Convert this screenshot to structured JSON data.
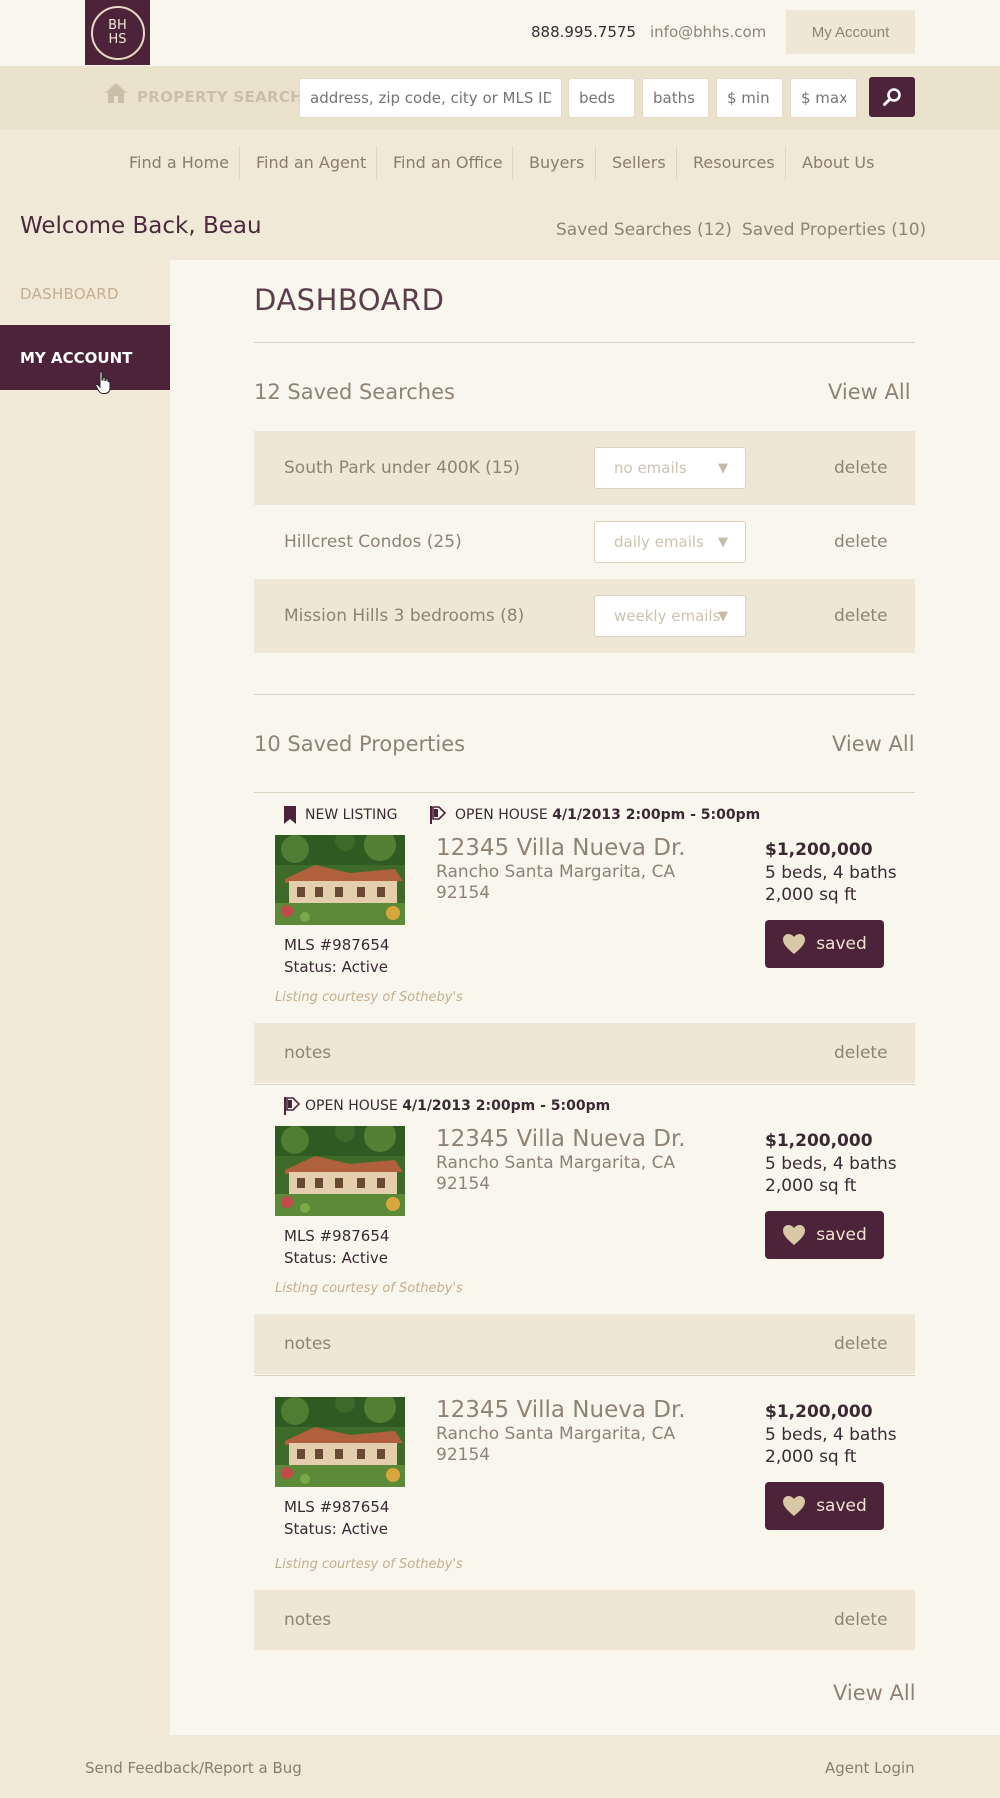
{
  "header": {
    "logo_text": "BH HS",
    "phone": "888.995.7575",
    "email": "info@bhhs.com",
    "my_account": "My Account"
  },
  "search": {
    "label": "PROPERTY SEARCH",
    "address_placeholder": "address, zip code, city or MLS ID",
    "beds_placeholder": "beds",
    "baths_placeholder": "baths",
    "min_placeholder": "$ min",
    "max_placeholder": "$ max"
  },
  "nav": {
    "items": [
      "Find a Home",
      "Find an Agent",
      "Find an Office",
      "Buyers",
      "Sellers",
      "Resources",
      "About Us"
    ]
  },
  "welcome": {
    "text": "Welcome Back, Beau",
    "saved_searches": "Saved Searches (12)",
    "saved_properties": "Saved Properties (10)"
  },
  "sidebar": {
    "dashboard": "DASHBOARD",
    "my_account": "MY ACCOUNT"
  },
  "main": {
    "title": "DASHBOARD",
    "saved_searches_title": "12 Saved Searches",
    "view_all": "View All",
    "saved_searches": [
      {
        "name": "South Park under 400K (15)",
        "email": "no emails",
        "delete": "delete"
      },
      {
        "name": "Hillcrest Condos (25)",
        "email": "daily emails",
        "delete": "delete"
      },
      {
        "name": "Mission Hills 3 bedrooms (8)",
        "email": "weekly emails",
        "delete": "delete"
      }
    ],
    "saved_properties_title": "10 Saved Properties",
    "properties": [
      {
        "new_listing": "NEW LISTING",
        "open_house_label": "OPEN HOUSE",
        "open_house_time": "4/1/2013 2:00pm - 5:00pm",
        "address": "12345 Villa Nueva Dr.",
        "city": "Rancho Santa Margarita, CA",
        "zip": "92154",
        "price": "$1,200,000",
        "beds_baths": "5 beds, 4 baths",
        "sqft": "2,000 sq ft",
        "saved": "saved",
        "mls": "MLS #987654",
        "status": "Status: Active",
        "courtesy": "Listing courtesy of Sotheby's",
        "notes": "notes",
        "delete": "delete"
      },
      {
        "open_house_label": "OPEN HOUSE",
        "open_house_time": "4/1/2013 2:00pm - 5:00pm",
        "address": "12345 Villa Nueva Dr.",
        "city": "Rancho Santa Margarita, CA",
        "zip": "92154",
        "price": "$1,200,000",
        "beds_baths": "5 beds, 4 baths",
        "sqft": "2,000 sq ft",
        "saved": "saved",
        "mls": "MLS #987654",
        "status": "Status: Active",
        "courtesy": "Listing courtesy of Sotheby's",
        "notes": "notes",
        "delete": "delete"
      },
      {
        "address": "12345 Villa Nueva Dr.",
        "city": "Rancho Santa Margarita, CA",
        "zip": "92154",
        "price": "$1,200,000",
        "beds_baths": "5 beds, 4 baths",
        "sqft": "2,000 sq ft",
        "saved": "saved",
        "mls": "MLS #987654",
        "status": "Status: Active",
        "courtesy": "Listing courtesy of Sotheby's",
        "notes": "notes",
        "delete": "delete"
      }
    ]
  },
  "footer": {
    "feedback": "Send Feedback/Report a Bug",
    "agent_login": "Agent Login"
  },
  "colors": {
    "brand": "#4c2339",
    "background": "#f9f6ee",
    "band": "#f1e9d8",
    "muted_text": "#8f8373"
  }
}
